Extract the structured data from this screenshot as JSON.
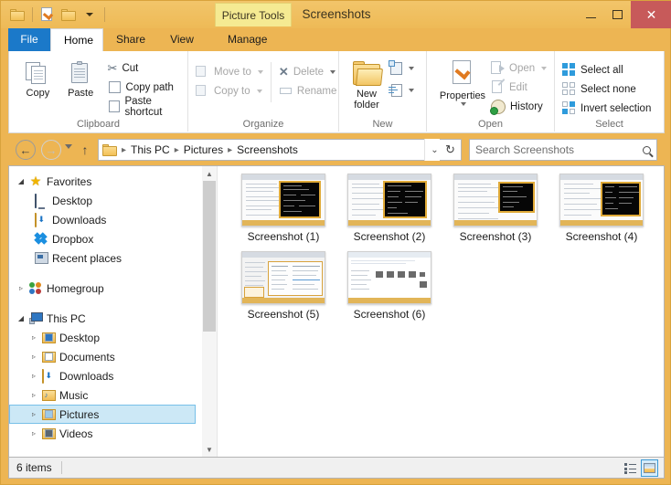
{
  "window": {
    "title": "Screenshots",
    "contextual_tab": "Picture Tools",
    "min_label": "Minimize",
    "max_label": "Maximize",
    "close_label": "✕"
  },
  "quick_access": [
    {
      "name": "folder-icon",
      "label": "Folder"
    },
    {
      "name": "properties-icon",
      "label": "Properties"
    },
    {
      "name": "new-folder-icon",
      "label": "New folder"
    },
    {
      "name": "customize-caret-icon",
      "label": "Customize Quick Access Toolbar"
    }
  ],
  "tabs": [
    {
      "label": "File",
      "active": false,
      "kind": "file"
    },
    {
      "label": "Home",
      "active": true,
      "kind": "normal"
    },
    {
      "label": "Share",
      "active": false,
      "kind": "normal"
    },
    {
      "label": "View",
      "active": false,
      "kind": "normal"
    },
    {
      "label": "Manage",
      "active": false,
      "kind": "contextual"
    }
  ],
  "ribbon": {
    "collapse_label": "⌃",
    "help_label": "?",
    "groups": [
      {
        "name": "Clipboard",
        "big_buttons": [
          {
            "label": "Copy",
            "icon": "copy-icon"
          },
          {
            "label": "Paste",
            "icon": "paste-icon"
          }
        ],
        "small_buttons": [
          {
            "label": "Cut",
            "icon": "scissors-icon",
            "disabled": false,
            "caret": false
          },
          {
            "label": "Copy path",
            "icon": "copy-path-icon",
            "disabled": false,
            "caret": false
          },
          {
            "label": "Paste shortcut",
            "icon": "paste-shortcut-icon",
            "disabled": false,
            "caret": false
          }
        ]
      },
      {
        "name": "Organize",
        "small_buttons": [
          {
            "label": "Move to",
            "icon": "move-to-icon",
            "disabled": true,
            "caret": true
          },
          {
            "label": "Copy to",
            "icon": "copy-to-icon",
            "disabled": true,
            "caret": true
          },
          {
            "label": "Delete",
            "icon": "delete-x-icon",
            "disabled": true,
            "caret": true
          },
          {
            "label": "Rename",
            "icon": "rename-icon",
            "disabled": true,
            "caret": false
          }
        ]
      },
      {
        "name": "New",
        "big_buttons": [
          {
            "label": "New\nfolder",
            "label_line1": "New",
            "label_line2": "folder",
            "icon": "new-folder-icon"
          }
        ],
        "small_buttons": [
          {
            "label": "New item",
            "icon": "new-item-icon",
            "disabled": false,
            "caret": true
          },
          {
            "label": "Easy access",
            "icon": "easy-access-icon",
            "disabled": false,
            "caret": true
          }
        ]
      },
      {
        "name": "Open",
        "big_buttons": [
          {
            "label": "Properties",
            "icon": "properties-icon",
            "caret": true
          }
        ],
        "small_buttons": [
          {
            "label": "Open",
            "icon": "open-icon",
            "disabled": true,
            "caret": true
          },
          {
            "label": "Edit",
            "icon": "edit-icon",
            "disabled": true,
            "caret": false
          },
          {
            "label": "History",
            "icon": "history-icon",
            "disabled": false,
            "caret": false
          }
        ]
      },
      {
        "name": "Select",
        "small_buttons": [
          {
            "label": "Select all",
            "icon": "select-all-icon",
            "disabled": false,
            "caret": false
          },
          {
            "label": "Select none",
            "icon": "select-none-icon",
            "disabled": false,
            "caret": false
          },
          {
            "label": "Invert selection",
            "icon": "invert-selection-icon",
            "disabled": false,
            "caret": false
          }
        ]
      }
    ]
  },
  "address_bar": {
    "back_icon": "←",
    "forward_icon": "→",
    "recent_locations_icon": "chevron-down-icon",
    "up_icon": "↑",
    "breadcrumbs": [
      "This PC",
      "Pictures",
      "Screenshots"
    ],
    "separator": "▸",
    "dropdown_icon": "⌄",
    "refresh_icon": "↻"
  },
  "search": {
    "placeholder": "Search Screenshots",
    "icon": "search-icon"
  },
  "nav_pane": {
    "groups": [
      {
        "root": {
          "label": "Favorites",
          "icon": "star-icon",
          "expander": "◢",
          "expanded": true
        },
        "children": [
          {
            "label": "Desktop",
            "icon": "desktop-icon"
          },
          {
            "label": "Downloads",
            "icon": "downloads-folder-icon"
          },
          {
            "label": "Dropbox",
            "icon": "dropbox-icon"
          },
          {
            "label": "Recent places",
            "icon": "recent-places-icon"
          }
        ]
      },
      {
        "root": {
          "label": "Homegroup",
          "icon": "homegroup-icon",
          "expander": "▹",
          "expanded": false
        },
        "children": []
      },
      {
        "root": {
          "label": "This PC",
          "icon": "this-pc-icon",
          "expander": "◢",
          "expanded": true
        },
        "children": [
          {
            "label": "Desktop",
            "icon": "desktop-folder-icon",
            "expander": "▹",
            "selected": false
          },
          {
            "label": "Documents",
            "icon": "documents-folder-icon",
            "expander": "▹",
            "selected": false
          },
          {
            "label": "Downloads",
            "icon": "downloads-folder-icon",
            "expander": "▹",
            "selected": false
          },
          {
            "label": "Music",
            "icon": "music-folder-icon",
            "expander": "▹",
            "selected": false
          },
          {
            "label": "Pictures",
            "icon": "pictures-folder-icon",
            "expander": "▹",
            "selected": true
          },
          {
            "label": "Videos",
            "icon": "videos-folder-icon",
            "expander": "▹",
            "selected": false
          }
        ]
      }
    ]
  },
  "files": [
    {
      "name": "Screenshot (1)",
      "thumb": "code-terminal"
    },
    {
      "name": "Screenshot (2)",
      "thumb": "code-terminal"
    },
    {
      "name": "Screenshot (3)",
      "thumb": "code-terminal-wide"
    },
    {
      "name": "Screenshot (4)",
      "thumb": "code-terminal-wide"
    },
    {
      "name": "Screenshot (5)",
      "thumb": "explorer-window"
    },
    {
      "name": "Screenshot (6)",
      "thumb": "explorer-thumbs"
    }
  ],
  "status_bar": {
    "item_count": "6 items",
    "views": [
      {
        "name": "details-view-button",
        "label": "Details view",
        "active": false
      },
      {
        "name": "large-icons-view-button",
        "label": "Large icons view",
        "active": true
      }
    ]
  },
  "colors": {
    "title_bar": "#eeba56",
    "file_tab": "#1b79c9",
    "close_button": "#c75a5a",
    "contextual_tab": "#f5ea92",
    "selection": "#cce8f6",
    "selection_border": "#77c0e8"
  }
}
